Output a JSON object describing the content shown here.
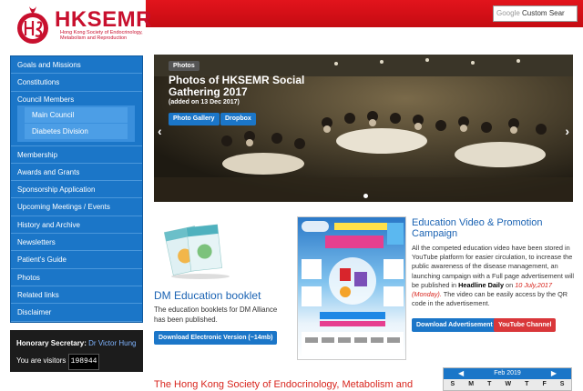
{
  "header": {
    "logo_title": "HKSEMR",
    "logo_subtitle": "Hong Kong Society of Endocrinology, Metabolism and Reproduction",
    "search_prefix": "Google",
    "search_placeholder": "Custom Sear"
  },
  "sidebar": {
    "items": [
      {
        "label": "Goals and Missions"
      },
      {
        "label": "Constitutions"
      },
      {
        "label": "Council Members",
        "children": [
          "Main Council",
          "Diabetes Division"
        ]
      },
      {
        "label": "Membership"
      },
      {
        "label": "Awards and Grants"
      },
      {
        "label": "Sponsorship Application"
      },
      {
        "label": "Upcoming Meetings / Events"
      },
      {
        "label": "History and Archive"
      },
      {
        "label": "Newsletters"
      },
      {
        "label": "Patient's Guide"
      },
      {
        "label": "Photos"
      },
      {
        "label": "Related links"
      },
      {
        "label": "Disclaimer"
      }
    ],
    "secretary_label": "Honorary Secretary:",
    "secretary_name": "Dr Victor Hung",
    "visitors_label": "You are visitors",
    "visitors_count": "198944"
  },
  "carousel": {
    "tag": "Photos",
    "title": "Photos of HKSEMR Social Gathering 2017",
    "date": "(added on 13 Dec 2017)",
    "button1": "Photo Gallery",
    "button2": "Dropbox",
    "prev": "‹",
    "next": "›"
  },
  "booklet": {
    "title": "DM Education booklet",
    "text": "The education booklets for DM Alliance has been published.",
    "button": "Download Electronic Version (~14mb)"
  },
  "education": {
    "title": "Education Video & Promotion Campaign",
    "text_a": "All the competed education video have been stored in YouTube platform for easier circulation, to increase the public awareness of the disease management, an launching campaign with a Full page advertisement will be published in ",
    "text_b": "Headline Daily",
    "text_c": " on ",
    "text_d": "10 July,2017 (Monday).",
    "text_e": " The video can be easily access by the QR code in the advertisement.",
    "button1": "Download Advertisement",
    "button2": "YouTube Channel"
  },
  "footer": {
    "title": "The Hong Kong Society of Endocrinology, Metabolism and"
  },
  "calendar": {
    "month": "Feb 2019",
    "prev": "◀",
    "next": "▶",
    "days": [
      "S",
      "M",
      "T",
      "W",
      "T",
      "F",
      "S"
    ]
  },
  "colors": {
    "brand_red": "#c8102e",
    "nav_blue": "#1b76c8"
  }
}
